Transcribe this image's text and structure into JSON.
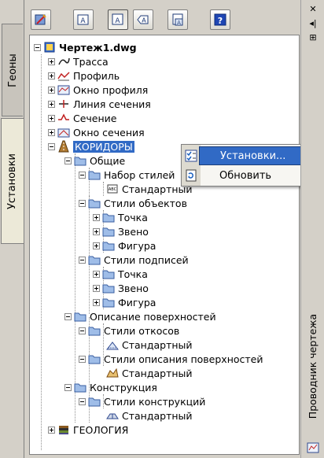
{
  "left_tabs": [
    {
      "label": "Геоны",
      "active": false
    },
    {
      "label": "Установки",
      "active": true
    }
  ],
  "toolbar": {
    "buttons": [
      {
        "icon": "settings-edit-icon"
      },
      {
        "icon": "label-style-icon-1"
      },
      {
        "icon": "label-style-icon-2"
      },
      {
        "icon": "label-style-icon-3"
      },
      {
        "icon": "label-style-icon-4"
      },
      {
        "icon": "help-icon",
        "label": "?"
      }
    ]
  },
  "tree": {
    "root": "Чертеж1.dwg",
    "items": [
      {
        "label": "Трасса"
      },
      {
        "label": "Профиль"
      },
      {
        "label": "Окно профиля"
      },
      {
        "label": "Линия сечения"
      },
      {
        "label": "Сечение"
      },
      {
        "label": "Окно сечения"
      },
      {
        "label": "КОРИДОРЫ"
      },
      {
        "label": "Общие"
      },
      {
        "label": "Набор стилей"
      },
      {
        "label": "Стандартный"
      },
      {
        "label": "Стили объектов"
      },
      {
        "label": "Точка"
      },
      {
        "label": "Звено"
      },
      {
        "label": "Фигура"
      },
      {
        "label": "Стили подписей"
      },
      {
        "label": "Точка"
      },
      {
        "label": "Звено"
      },
      {
        "label": "Фигура"
      },
      {
        "label": "Описание поверхностей"
      },
      {
        "label": "Стили откосов"
      },
      {
        "label": "Стандартный"
      },
      {
        "label": "Стили описания поверхностей"
      },
      {
        "label": "Стандартный"
      },
      {
        "label": "Конструкция"
      },
      {
        "label": "Стили конструкций"
      },
      {
        "label": "Стандартный"
      },
      {
        "label": "ГЕОЛОГИЯ"
      }
    ]
  },
  "context_menu": {
    "items": [
      {
        "label": "Установки..."
      },
      {
        "label": "Обновить"
      }
    ]
  },
  "right_strip": {
    "close": "✕",
    "pin": "◂|",
    "properties": "⊞",
    "title": "Проводник чертежа"
  },
  "colors": {
    "selection": "#316ac5",
    "panel": "#d4d0c8"
  }
}
